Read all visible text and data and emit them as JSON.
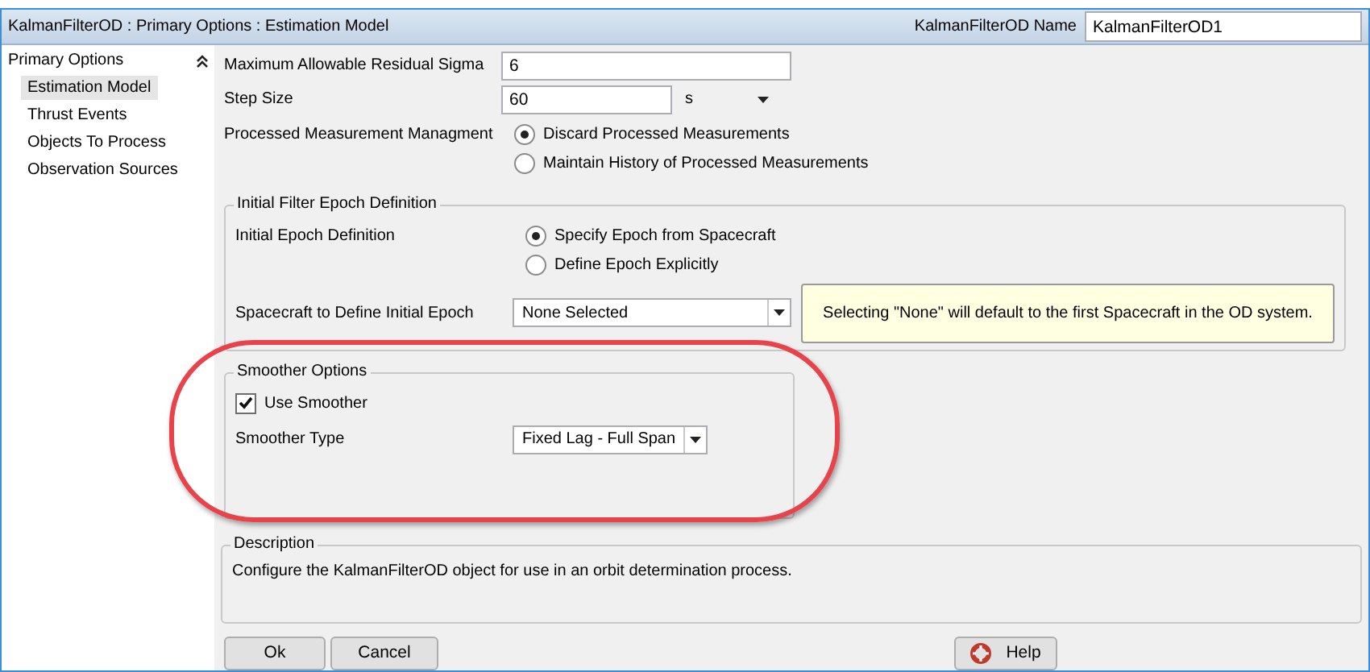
{
  "window": {
    "title": "KalmanFilterOD : Primary Options : Estimation Model",
    "name_label": "KalmanFilterOD Name",
    "name_value": "KalmanFilterOD1"
  },
  "sidebar": {
    "heading": "Primary Options",
    "expanded": true,
    "items": [
      {
        "label": "Estimation Model",
        "selected": true
      },
      {
        "label": "Thrust Events",
        "selected": false
      },
      {
        "label": "Objects To Process",
        "selected": false
      },
      {
        "label": "Observation Sources",
        "selected": false
      }
    ]
  },
  "fields": [
    {
      "kind": "text",
      "label": "Maximum Allowable Residual Sigma",
      "value": "6"
    },
    {
      "kind": "unit",
      "label": "Step Size",
      "value": "60",
      "unit": "s"
    },
    {
      "kind": "radio",
      "label": "Processed Measurement Managment",
      "options": [
        {
          "label": "Discard Processed Measurements",
          "selected": true
        },
        {
          "label": "Maintain History of Processed Measurements",
          "selected": false
        }
      ]
    }
  ],
  "epoch_group": {
    "title": "Initial Filter Epoch Definition",
    "label": "Initial Epoch Definition",
    "options": [
      {
        "label": "Specify Epoch from Spacecraft",
        "selected": true
      },
      {
        "label": "Define Epoch Explicitly",
        "selected": false
      }
    ],
    "spacecraft_label": "Spacecraft to Define Initial Epoch",
    "spacecraft_value": "None Selected",
    "note": "Selecting \"None\" will default to the first Spacecraft in the OD system."
  },
  "smoother_group": {
    "title": "Smoother Options",
    "use_label": "Use Smoother",
    "checked": true,
    "type_label": "Smoother Type",
    "type_value": "Fixed Lag - Full Span",
    "highlighted": true
  },
  "description": {
    "title": "Description",
    "text": "Configure the KalmanFilterOD object for use in an orbit determination process."
  },
  "buttons": [
    {
      "kind": "ok",
      "label": "Ok"
    },
    {
      "kind": "cancel",
      "label": "Cancel"
    },
    {
      "kind": "help",
      "label": "Help"
    }
  ]
}
